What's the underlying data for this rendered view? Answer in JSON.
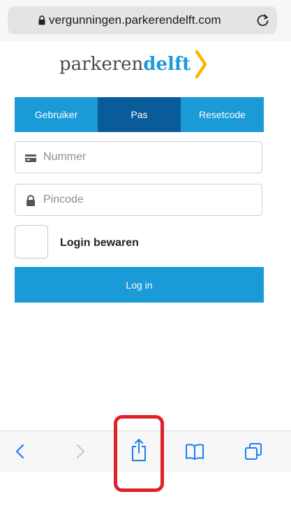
{
  "browser": {
    "url": "vergunningen.parkerendelft.com"
  },
  "logo": {
    "part1": "parkeren",
    "part2": "delft"
  },
  "tabs": [
    {
      "label": "Gebruiker",
      "active": false
    },
    {
      "label": "Pas",
      "active": true
    },
    {
      "label": "Resetcode",
      "active": false
    }
  ],
  "form": {
    "number_placeholder": "Nummer",
    "pin_placeholder": "Pincode",
    "remember_label": "Login bewaren",
    "login_label": "Log in"
  },
  "colors": {
    "accent": "#1a9ad6",
    "active_tab": "#0a5b9a",
    "highlight": "#e0202a",
    "logo_chevron": "#f5b800"
  },
  "toolbar": {
    "icons": [
      "back-icon",
      "forward-icon",
      "share-icon",
      "bookmarks-icon",
      "tabs-icon"
    ]
  }
}
